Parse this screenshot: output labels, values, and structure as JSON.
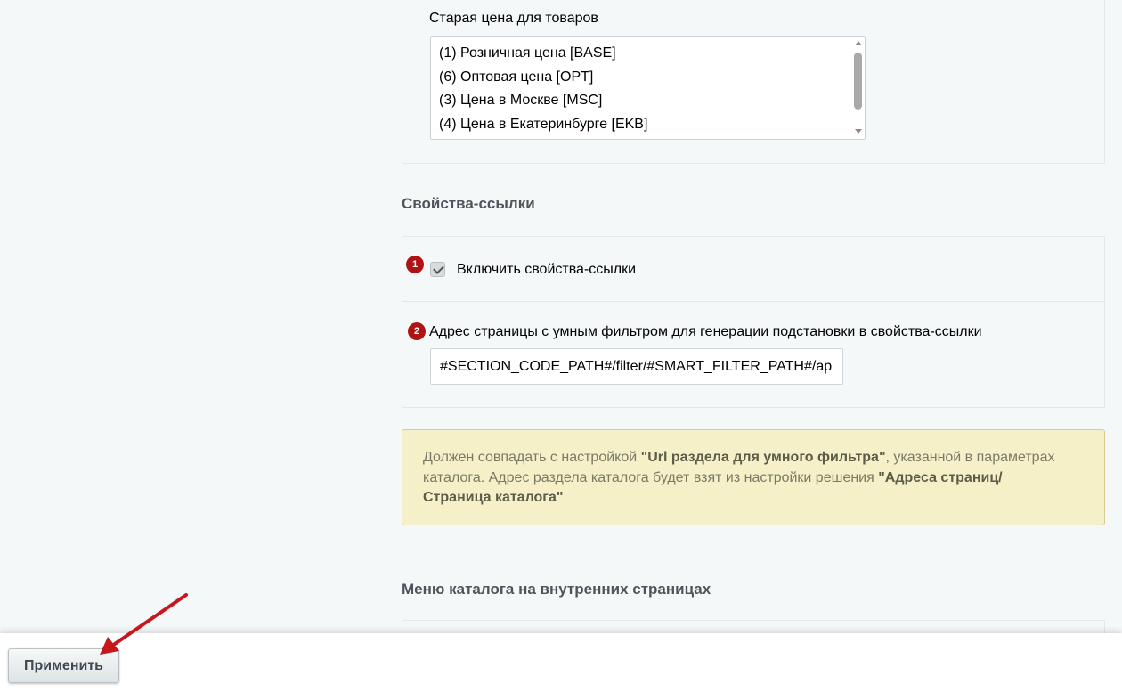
{
  "old_price": {
    "label": "Старая цена для товаров",
    "options": [
      "(1) Розничная цена [BASE]",
      "(6) Оптовая цена [OPT]",
      "(3) Цена в Москве [MSC]",
      "(4) Цена в Екатеринбурге [EKB]"
    ]
  },
  "link_props": {
    "section_title": "Свойства-ссылки",
    "badge1": "1",
    "enable_label": "Включить свойства-ссылки",
    "enable_checked": true,
    "badge2": "2",
    "url_label": "Адрес страницы с умным фильтром для генерации подстановки в свойства-ссылки",
    "url_value": "#SECTION_CODE_PATH#/filter/#SMART_FILTER_PATH#/apply/"
  },
  "notice": {
    "part1": "Должен совпадать с настройкой ",
    "bold1": "\"Url раздела для умного фильтра\"",
    "part2": ", указанной в параметрах каталога. Адрес раздела каталога будет взят из настройки решения ",
    "bold2": "\"Адреса страниц/ Страница каталога\""
  },
  "menu_section": {
    "title": "Меню каталога на внутренних страницах"
  },
  "footer": {
    "apply_label": "Применить"
  },
  "colors": {
    "badge": "#b01313",
    "arrow": "#c8161d",
    "notice_bg": "#f5f0c8"
  }
}
